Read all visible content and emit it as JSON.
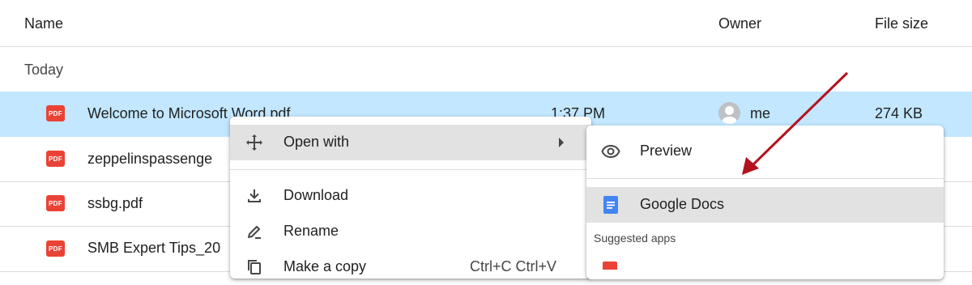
{
  "header": {
    "name": "Name",
    "owner": "Owner",
    "file_size": "File size"
  },
  "section": "Today",
  "files": [
    {
      "name": "Welcome to Microsoft Word.pdf",
      "modified": "1:37 PM",
      "owner": "me",
      "size": "274 KB",
      "icon": "pdf-icon",
      "icon_text": "PDF"
    },
    {
      "name": "zeppelinspassenge",
      "icon": "pdf-icon",
      "icon_text": "PDF"
    },
    {
      "name": "ssbg.pdf",
      "icon": "pdf-icon",
      "icon_text": "PDF"
    },
    {
      "name": "SMB Expert Tips_20",
      "icon": "pdf-icon",
      "icon_text": "PDF"
    }
  ],
  "context_menu": {
    "items": [
      {
        "label": "Open with",
        "icon": "open-with-move-icon",
        "has_submenu": true
      },
      {
        "label": "Download",
        "icon": "download-icon"
      },
      {
        "label": "Rename",
        "icon": "rename-pencil-icon"
      },
      {
        "label": "Make a copy",
        "icon": "copy-icon",
        "shortcut": "Ctrl+C Ctrl+V"
      }
    ]
  },
  "open_with_submenu": {
    "items": [
      {
        "label": "Preview",
        "icon": "eye-icon"
      },
      {
        "label": "Google Docs",
        "icon": "google-docs-icon"
      }
    ],
    "suggested_label": "Suggested apps"
  },
  "colors": {
    "selected_row": "#c2e7ff",
    "menu_highlight": "#e2e2e2",
    "pdf_red": "#ea4335",
    "docs_blue": "#4285f4",
    "arrow": "#b3121d"
  }
}
